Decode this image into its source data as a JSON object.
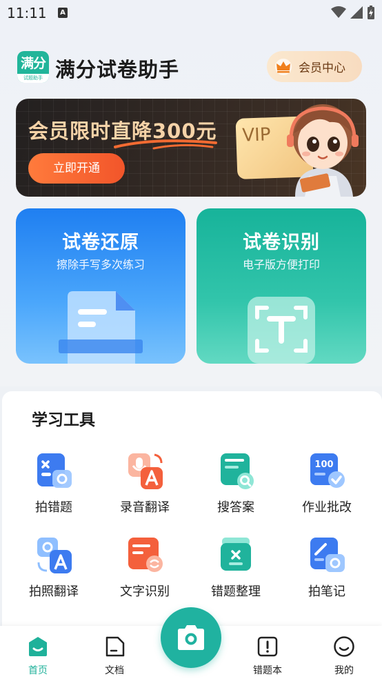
{
  "status_bar": {
    "time": "11:11",
    "notification_glyph": "A"
  },
  "header": {
    "logo_text": "满分",
    "logo_subtext": "试题助手",
    "app_title": "满分试卷助手",
    "vip_center_label": "会员中心"
  },
  "banner": {
    "title": "会员限时直降300元",
    "button_label": "立即开通",
    "vip_card_text": "VIP"
  },
  "feature_cards": [
    {
      "title": "试卷还原",
      "subtitle": "擦除手写多次练习",
      "color": "#2a8cf4"
    },
    {
      "title": "试卷识别",
      "subtitle": "电子版方便打印",
      "color": "#1fb79f"
    }
  ],
  "tools": {
    "title": "学习工具",
    "items": [
      {
        "label": "拍错题",
        "icon": "photo-mistake-icon"
      },
      {
        "label": "录音翻译",
        "icon": "audio-translate-icon"
      },
      {
        "label": "搜答案",
        "icon": "search-answer-icon"
      },
      {
        "label": "作业批改",
        "icon": "homework-grade-icon"
      },
      {
        "label": "拍照翻译",
        "icon": "photo-translate-icon"
      },
      {
        "label": "文字识别",
        "icon": "text-recognition-icon"
      },
      {
        "label": "错题整理",
        "icon": "mistake-organize-icon"
      },
      {
        "label": "拍笔记",
        "icon": "photo-note-icon"
      }
    ]
  },
  "bottom_nav": {
    "items": [
      {
        "label": "首页",
        "icon": "home-icon",
        "active": true
      },
      {
        "label": "文档",
        "icon": "document-icon",
        "active": false
      },
      {
        "label": "错题本",
        "icon": "mistake-book-icon",
        "active": false
      },
      {
        "label": "我的",
        "icon": "profile-icon",
        "active": false
      }
    ],
    "center_icon": "camera-icon"
  },
  "colors": {
    "brand_green": "#20b2a0",
    "accent_orange": "#f2552a",
    "vip_gold": "#f6d3a8"
  }
}
